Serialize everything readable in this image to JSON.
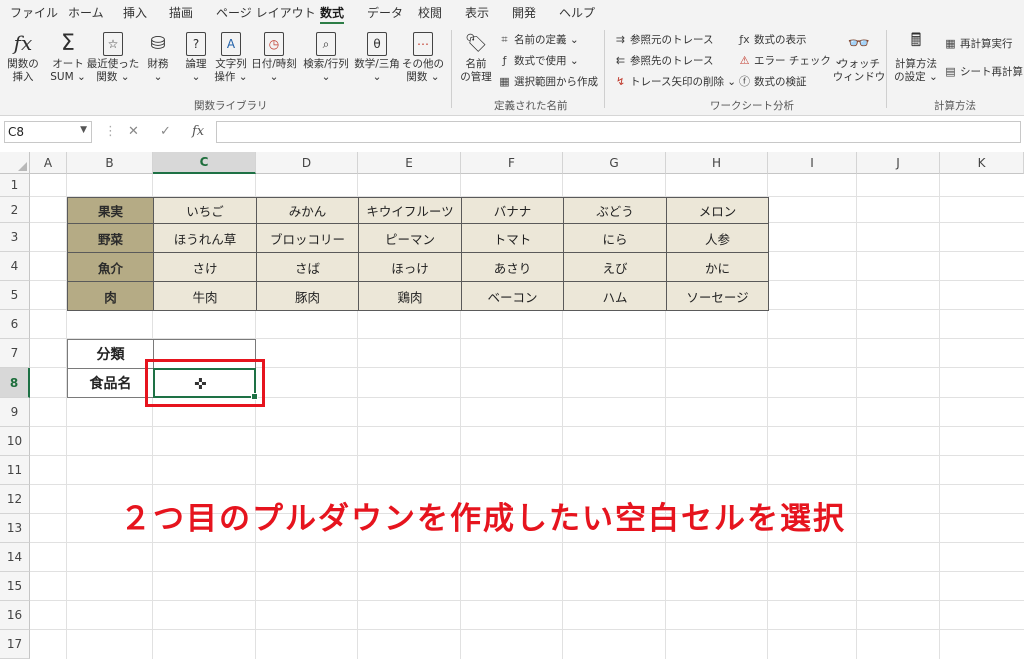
{
  "menu": {
    "tabs": [
      "ファイル",
      "ホーム",
      "挿入",
      "描画",
      "ページ レイアウト",
      "数式",
      "データ",
      "校閲",
      "表示",
      "開発",
      "ヘルプ"
    ],
    "active_tab": "数式"
  },
  "ribbon": {
    "function_library": {
      "insert_function": "関数の\n挿入",
      "autosum": "オート\nSUM ⌄",
      "recent": "最近使った\n関数 ⌄",
      "financial": "財務\n⌄",
      "logical": "論理\n⌄",
      "text": "文字列\n操作 ⌄",
      "datetime": "日付/時刻\n⌄",
      "lookup": "検索/行列\n⌄",
      "math": "数学/三角\n⌄",
      "more": "その他の\n関数 ⌄",
      "group_label": "関数ライブラリ"
    },
    "defined_names": {
      "name_manager": "名前\nの管理",
      "define_name": "名前の定義 ⌄",
      "use_in_formula": "数式で使用 ⌄",
      "create_from_selection": "選択範囲から作成",
      "group_label": "定義された名前"
    },
    "formula_auditing": {
      "trace_precedents": "参照元のトレース",
      "trace_dependents": "参照先のトレース",
      "remove_arrows": "トレース矢印の削除 ⌄",
      "show_formulas": "数式の表示",
      "error_checking": "エラー チェック ⌄",
      "evaluate_formula": "数式の検証",
      "watch_window": "ウォッチ\nウィンドウ",
      "group_label": "ワークシート分析"
    },
    "calculation": {
      "options": "計算方法\nの設定 ⌄",
      "calc_now": "再計算実行",
      "calc_sheet": "シート再計算",
      "group_label": "計算方法"
    }
  },
  "formula_bar": {
    "name_box": "C8",
    "cancel_icon": "✕",
    "enter_icon": "✓",
    "fx_label": "fx",
    "formula": ""
  },
  "grid": {
    "columns": [
      "A",
      "B",
      "C",
      "D",
      "E",
      "F",
      "G",
      "H",
      "I",
      "J",
      "K"
    ],
    "rows": [
      "1",
      "2",
      "3",
      "4",
      "5",
      "6",
      "7",
      "8",
      "9",
      "10",
      "11",
      "12",
      "13",
      "14",
      "15",
      "16",
      "17"
    ],
    "selected_column": "C",
    "selected_row": "8"
  },
  "food_table": {
    "categories": [
      "果実",
      "野菜",
      "魚介",
      "肉"
    ],
    "rows": [
      [
        "いちご",
        "みかん",
        "キウイフルーツ",
        "バナナ",
        "ぶどう",
        "メロン"
      ],
      [
        "ほうれん草",
        "ブロッコリー",
        "ピーマン",
        "トマト",
        "にら",
        "人参"
      ],
      [
        "さけ",
        "さば",
        "ほっけ",
        "あさり",
        "えび",
        "かに"
      ],
      [
        "牛肉",
        "豚肉",
        "鶏肉",
        "ベーコン",
        "ハム",
        "ソーセージ"
      ]
    ]
  },
  "form": {
    "category_label": "分類",
    "category_value": "",
    "food_label": "食品名",
    "food_value": ""
  },
  "annotation": {
    "caption": "２つ目のプルダウンを作成したい空白セルを選択",
    "color": "#e6141e"
  },
  "colors": {
    "category_fill": "#b5ab85",
    "value_fill": "#ece7d8",
    "selection": "#1e7145"
  }
}
